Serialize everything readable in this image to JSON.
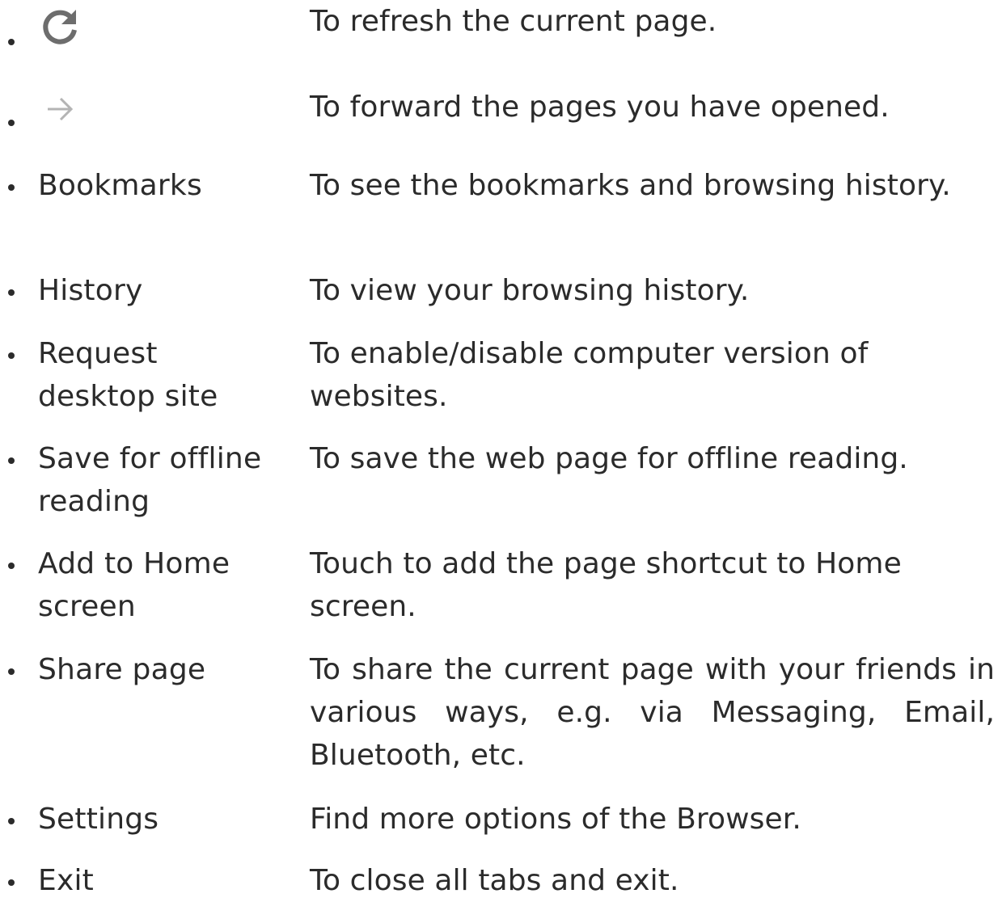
{
  "items": [
    {
      "icon": "refresh-icon",
      "desc": "To refresh the current page."
    },
    {
      "icon": "arrow-forward-icon",
      "desc": "To forward the pages you have opened."
    },
    {
      "term": "Bookmarks",
      "desc": "To see the bookmarks and browsing history."
    },
    {
      "term": "History",
      "desc": "To view your browsing history."
    },
    {
      "term": "Request desktop site",
      "desc": "To enable/disable computer version of websites."
    },
    {
      "term": "Save for offline reading",
      "desc": "To save the web page for offline reading."
    },
    {
      "term": "Add to Home screen",
      "desc": "Touch to add the page shortcut to Home screen."
    },
    {
      "term": "Share page",
      "desc": "To share the current page with your friends in various ways, e.g. via Messaging, Email, Bluetooth, etc."
    },
    {
      "term": "Settings",
      "desc": "Find more options of the Browser."
    },
    {
      "term": "Exit",
      "desc": "To close all tabs and exit."
    }
  ],
  "colors": {
    "text": "#2b2b2b",
    "icon_refresh": "#6d6d6d",
    "icon_forward": "#b4b4b4"
  }
}
